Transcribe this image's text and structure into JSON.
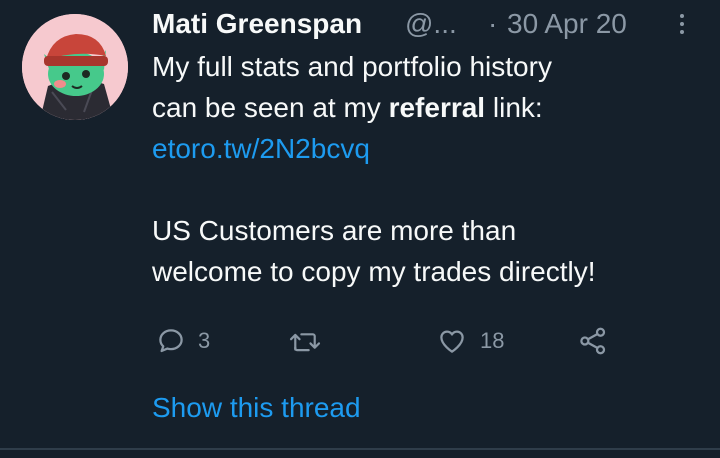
{
  "tweet": {
    "display_name": "Mati Greenspan",
    "handle": "@...",
    "dot": "·",
    "date": "30 Apr 20",
    "text_line1": "My full stats and portfolio history",
    "text_line2_pre": "can be seen at my ",
    "text_line2_bold": "referral",
    "text_line2_post": " link:",
    "link": "etoro.tw/2N2bcvq",
    "text_line5": "US Customers are more than",
    "text_line6": "welcome to copy my trades directly!"
  },
  "actions": {
    "reply_count": "3",
    "retweet_count": "",
    "like_count": "18"
  },
  "show_thread_label": "Show this thread",
  "icons": {
    "avatar": "avatar-green-creature-red-beanie",
    "more": "more-vertical-icon",
    "reply": "reply-icon",
    "retweet": "retweet-icon",
    "like": "heart-icon",
    "share": "share-icon"
  },
  "colors": {
    "background": "#15202b",
    "text": "#f7f9f9",
    "secondary": "#8b98a5",
    "link": "#1d9bf0",
    "avatar_bg": "#f6c9cf"
  }
}
